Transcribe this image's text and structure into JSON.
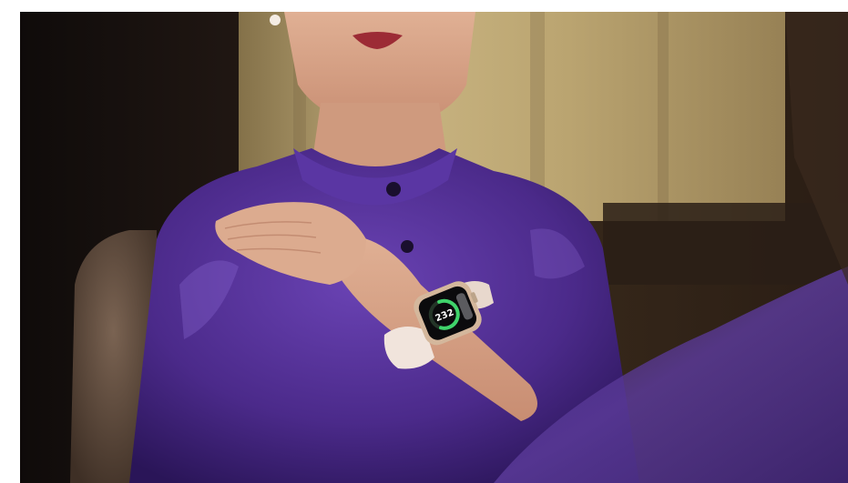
{
  "photo": {
    "subject": "woman-in-purple-shirt-wearing-smartwatch",
    "colors": {
      "shirt": "#4b2a8a",
      "shirt_highlight": "#7a55c4",
      "shirt_shadow": "#2a1558",
      "skin": "#d9a689",
      "curtain": "#c9b27a",
      "background_dark": "#1c130e",
      "watch_band": "#f1e4dc",
      "watch_ring": "#3fd36b"
    }
  },
  "watch_screen": {
    "readout": "232",
    "ring_fraction": 0.6
  }
}
